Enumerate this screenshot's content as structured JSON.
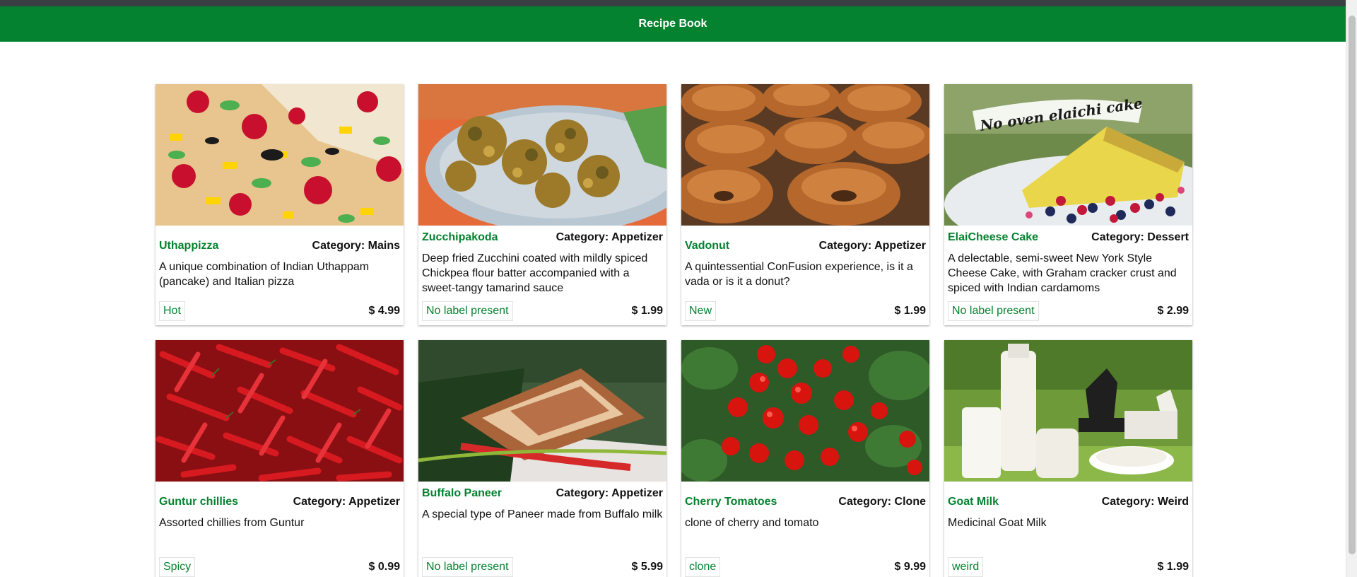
{
  "app": {
    "title": "Recipe Book"
  },
  "dishes": [
    {
      "name": "Uthappizza",
      "category": "Category: Mains",
      "description": "A unique combination of Indian Uthappam (pancake) and Italian pizza",
      "label": "Hot",
      "price": "$ 4.99",
      "image": "pizza"
    },
    {
      "name": "Zucchipakoda",
      "category": "Category: Appetizer",
      "description": "Deep fried Zucchini coated with mildly spiced Chickpea flour batter accompanied with a sweet-tangy tamarind sauce",
      "label": "No label present",
      "price": "$ 1.99",
      "image": "pakoda"
    },
    {
      "name": "Vadonut",
      "category": "Category: Appetizer",
      "description": "A quintessential ConFusion experience, is it a vada or is it a donut?",
      "label": "New",
      "price": "$ 1.99",
      "image": "donuts"
    },
    {
      "name": "ElaiCheese Cake",
      "category": "Category: Dessert",
      "description": "A delectable, semi-sweet New York Style Cheese Cake, with Graham cracker crust and spiced with Indian cardamoms",
      "label": "No label present",
      "price": "$ 2.99",
      "image": "cake",
      "image_caption": "No oven elaichi cake"
    },
    {
      "name": "Guntur chillies",
      "category": "Category: Appetizer",
      "description": "Assorted chillies from Guntur",
      "label": "Spicy",
      "price": "$ 0.99",
      "image": "chillies"
    },
    {
      "name": "Buffalo Paneer",
      "category": "Category: Appetizer",
      "description": "A special type of Paneer made from Buffalo milk",
      "label": "No label present",
      "price": "$ 5.99",
      "image": "paneer"
    },
    {
      "name": "Cherry Tomatoes",
      "category": "Category: Clone",
      "description": "clone of cherry and tomato",
      "label": "clone",
      "price": "$ 9.99",
      "image": "tomatoes"
    },
    {
      "name": "Goat Milk",
      "category": "Category: Weird",
      "description": "Medicinal Goat Milk",
      "label": "weird",
      "price": "$ 1.99",
      "image": "goatmilk"
    }
  ]
}
